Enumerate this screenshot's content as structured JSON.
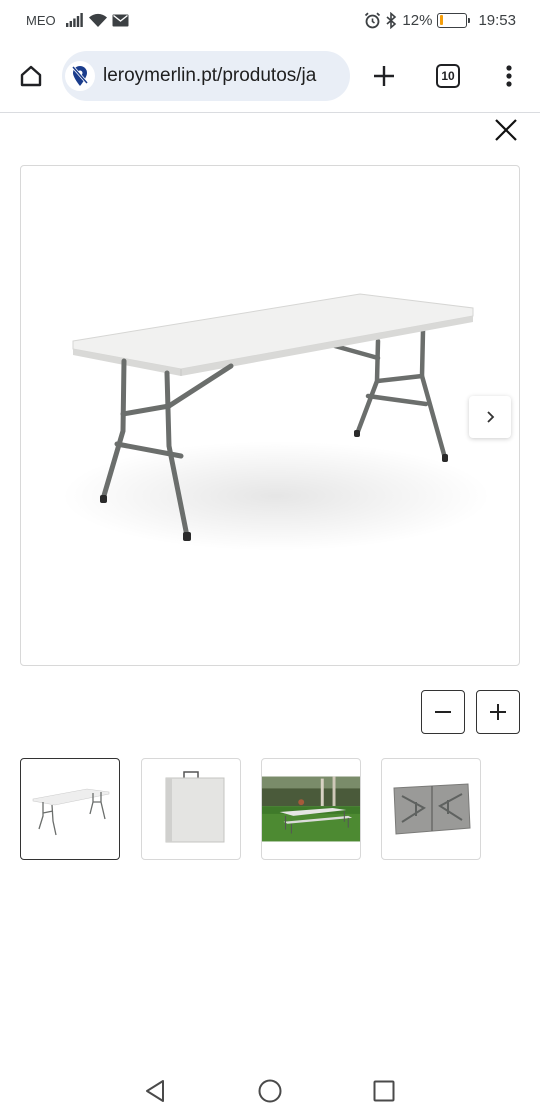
{
  "status_bar": {
    "carrier": "MEO",
    "battery_percent": "12%",
    "battery_level": 0.12,
    "battery_color": "#f59e0b",
    "time": "19:53",
    "icons": [
      "signal-icon",
      "wifi-icon",
      "mail-icon",
      "alarm-icon",
      "bluetooth-icon",
      "battery-icon"
    ]
  },
  "browser": {
    "url": "leroymerlin.pt/produtos/ja",
    "tab_count": "10",
    "omnibox_color": "#e9eef6",
    "site_icon_color": "#1a3c8c",
    "icons": [
      "home-icon",
      "site-info-icon",
      "plus-icon",
      "tabs-icon",
      "more-vert-icon"
    ]
  },
  "viewer": {
    "close_icon": "close-icon",
    "next_icon": "chevron-right-icon",
    "zoom_out_icon": "minus-icon",
    "zoom_in_icon": "plus-icon",
    "table_top_color": "#f1f1f0",
    "table_leg_color": "#6b6e6c"
  },
  "thumbnails": [
    {
      "name": "folding table open",
      "active": true
    },
    {
      "name": "folding table folded",
      "active": false
    },
    {
      "name": "table in garden",
      "active": false
    },
    {
      "name": "table underside",
      "active": false
    }
  ],
  "navbar": {
    "icons": [
      "back-triangle-icon",
      "home-circle-icon",
      "recents-square-icon"
    ]
  }
}
